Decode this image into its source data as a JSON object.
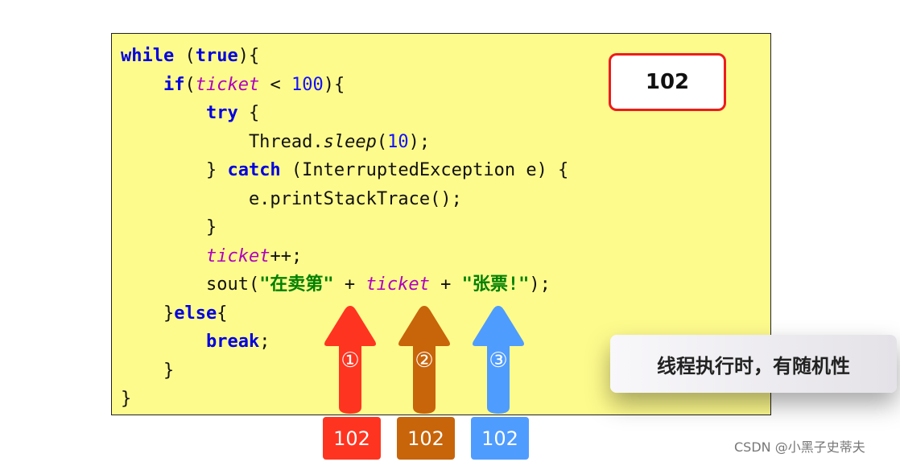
{
  "code_lines": [
    [
      {
        "t": "while",
        "c": "kw"
      },
      {
        "t": " ("
      },
      {
        "t": "true",
        "c": "kw"
      },
      {
        "t": "){"
      }
    ],
    [
      {
        "t": "    "
      },
      {
        "t": "if",
        "c": "kw"
      },
      {
        "t": "("
      },
      {
        "t": "ticket",
        "c": "var"
      },
      {
        "t": " < "
      },
      {
        "t": "100",
        "c": "num"
      },
      {
        "t": "){"
      }
    ],
    [
      {
        "t": "        "
      },
      {
        "t": "try",
        "c": "kw"
      },
      {
        "t": " {"
      }
    ],
    [
      {
        "t": "            Thread."
      },
      {
        "t": "sleep",
        "c": "it"
      },
      {
        "t": "("
      },
      {
        "t": "10",
        "c": "num"
      },
      {
        "t": ");"
      }
    ],
    [
      {
        "t": "        } "
      },
      {
        "t": "catch",
        "c": "kw"
      },
      {
        "t": " (InterruptedException e) {"
      }
    ],
    [
      {
        "t": "            e.printStackTrace();"
      }
    ],
    [
      {
        "t": "        }"
      }
    ],
    [
      {
        "t": "        "
      },
      {
        "t": "ticket",
        "c": "var"
      },
      {
        "t": "++;"
      }
    ],
    [
      {
        "t": "        sout("
      },
      {
        "t": "\"在卖第\"",
        "c": "str"
      },
      {
        "t": " + "
      },
      {
        "t": "ticket",
        "c": "var"
      },
      {
        "t": " + "
      },
      {
        "t": "\"张票!\"",
        "c": "str"
      },
      {
        "t": ");"
      }
    ],
    [
      {
        "t": "    }"
      },
      {
        "t": "else",
        "c": "kw"
      },
      {
        "t": "{"
      }
    ],
    [
      {
        "t": "        "
      },
      {
        "t": "break",
        "c": "kw"
      },
      {
        "t": ";"
      }
    ],
    [
      {
        "t": "    }"
      }
    ],
    [
      {
        "t": "}"
      }
    ]
  ],
  "counter": {
    "value": "102"
  },
  "threads": [
    {
      "label": "①",
      "value": "102",
      "color": "#ff3420"
    },
    {
      "label": "②",
      "value": "102",
      "color": "#c8640a"
    },
    {
      "label": "③",
      "value": "102",
      "color": "#4f9cff"
    }
  ],
  "tooltip": "线程执行时，有随机性",
  "watermark": "CSDN @小黑子史蒂夫"
}
